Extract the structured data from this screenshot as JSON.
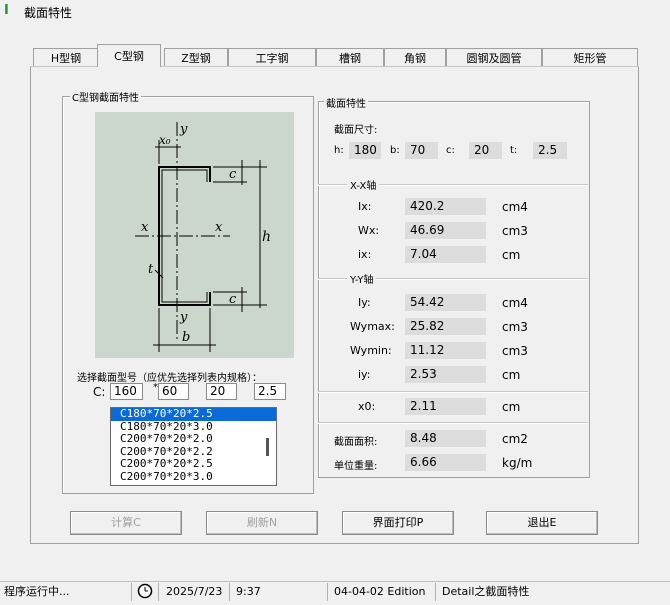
{
  "window": {
    "title": "截面特性"
  },
  "tabs": [
    {
      "label": "H型钢",
      "active": false
    },
    {
      "label": "C型钢",
      "active": true
    },
    {
      "label": "Z型钢",
      "active": false
    },
    {
      "label": "工字钢",
      "active": false
    },
    {
      "label": "槽钢",
      "active": false
    },
    {
      "label": "角钢",
      "active": false
    },
    {
      "label": "圆钢及圆管",
      "active": false
    },
    {
      "label": "矩形管",
      "active": false
    }
  ],
  "left_group": {
    "title": "C型钢截面特性"
  },
  "diagram": {
    "y_top": "y",
    "y_bottom": "y",
    "x_left": "x",
    "x_right": "x",
    "x0": "x₀",
    "c_top": "c",
    "c_bottom": "c",
    "h": "h",
    "t": "t",
    "b": "b"
  },
  "selection": {
    "prompt": "选择截面型号（应优先选择列表内规格）：",
    "prefix": "C:",
    "h_value": "160",
    "sep": "*",
    "b_value": "60",
    "c_value": "20",
    "t_value": "2.5",
    "list": [
      "C180*70*20*2.5",
      "C180*70*20*3.0",
      "C200*70*20*2.0",
      "C200*70*20*2.2",
      "C200*70*20*2.5",
      "C200*70*20*3.0"
    ],
    "selected_index": 0
  },
  "props": {
    "group_title": "截面特性",
    "dims_label": "截面尺寸:",
    "dims": [
      {
        "label": "h:",
        "value": "180"
      },
      {
        "label": "b:",
        "value": "70"
      },
      {
        "label": "c:",
        "value": "20"
      },
      {
        "label": "t:",
        "value": "2.5"
      }
    ],
    "xx_title": "X-X轴",
    "xx": [
      {
        "label": "Ix:",
        "value": "420.2",
        "unit": "cm4"
      },
      {
        "label": "Wx:",
        "value": "46.69",
        "unit": "cm3"
      },
      {
        "label": "ix:",
        "value": "7.04",
        "unit": "cm"
      }
    ],
    "yy_title": "Y-Y轴",
    "yy": [
      {
        "label": "Iy:",
        "value": "54.42",
        "unit": "cm4"
      },
      {
        "label": "Wymax:",
        "value": "25.82",
        "unit": "cm3"
      },
      {
        "label": "Wymin:",
        "value": "11.12",
        "unit": "cm3"
      },
      {
        "label": "iy:",
        "value": "2.53",
        "unit": "cm"
      }
    ],
    "x0": {
      "label": "x0:",
      "value": "2.11",
      "unit": "cm"
    },
    "area": {
      "label": "截面面积:",
      "value": "8.48",
      "unit": "cm2"
    },
    "weight": {
      "label": "单位重量:",
      "value": "6.66",
      "unit": "kg/m"
    }
  },
  "buttons": {
    "calc": "计算C",
    "refresh": "刷新N",
    "print": "界面打印P",
    "exit": "退出E"
  },
  "status": {
    "state": "程序运行中...",
    "date": "2025/7/23",
    "time": "9:37",
    "edition": "04-04-02 Edition",
    "detail": "Detail之截面特性"
  }
}
